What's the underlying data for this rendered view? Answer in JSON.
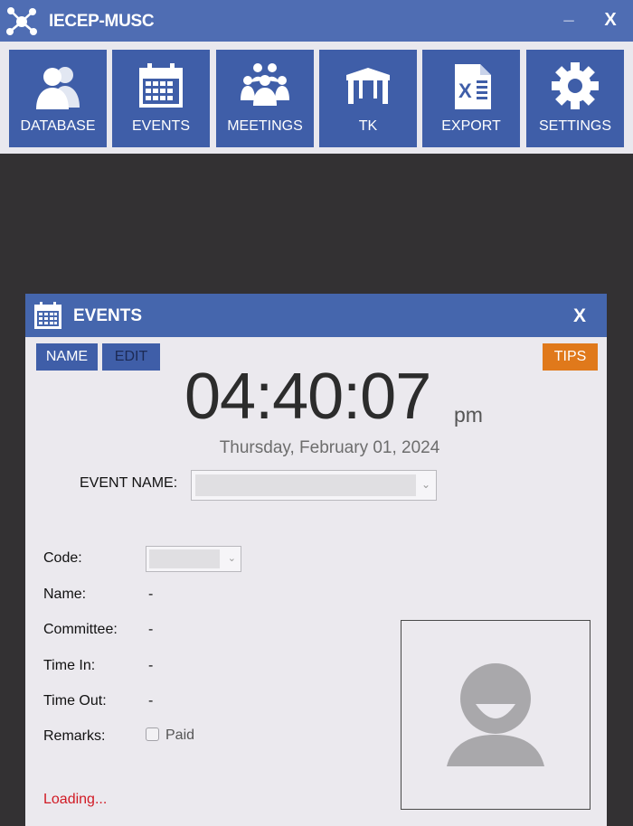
{
  "app": {
    "title": "IECEP-MUSC",
    "minimize_label": "_",
    "close_label": "X",
    "logo_icon": "network-nodes-icon"
  },
  "toolbar": {
    "buttons": [
      {
        "label": "DATABASE",
        "icon": "users-icon"
      },
      {
        "label": "EVENTS",
        "icon": "calendar-icon"
      },
      {
        "label": "MEETINGS",
        "icon": "group-icon"
      },
      {
        "label": "TK",
        "icon": "table-icon"
      },
      {
        "label": "EXPORT",
        "icon": "excel-icon"
      },
      {
        "label": "SETTINGS",
        "icon": "gear-icon"
      }
    ]
  },
  "events_window": {
    "title": "EVENTS",
    "close_label": "X",
    "name_button": "NAME",
    "edit_button": "EDIT",
    "tips_button": "TIPS",
    "clock": "04:40:07",
    "ampm": "pm",
    "date": "Thursday, February 01, 2024",
    "event_name_label": "EVENT NAME:",
    "event_name_value": "",
    "fields": {
      "code_label": "Code:",
      "code_value": "",
      "name_label": "Name:",
      "name_value": "-",
      "committee_label": "Committee:",
      "committee_value": "-",
      "time_in_label": "Time In:",
      "time_in_value": "-",
      "time_out_label": "Time Out:",
      "time_out_value": "-",
      "remarks_label": "Remarks:",
      "paid_label": "Paid",
      "paid_checked": false
    },
    "status": "Loading...",
    "photo_icon": "user-avatar-placeholder-icon"
  },
  "colors": {
    "titlebar": "#4f6db3",
    "button_blue": "#3f5ea8",
    "tips_orange": "#e0791b",
    "loading_red": "#d11a24",
    "background_dark": "#333133"
  }
}
